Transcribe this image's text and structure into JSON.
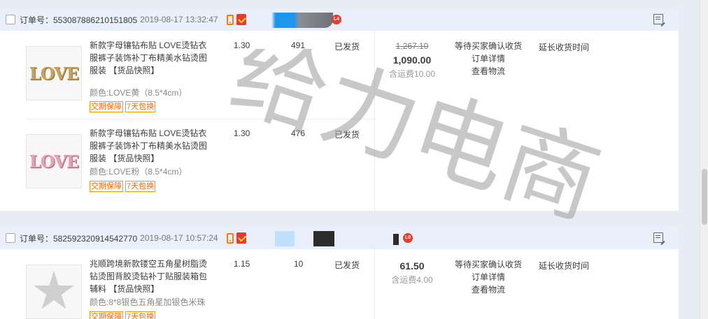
{
  "orders": [
    {
      "order_no": "订单号：553087886210151805",
      "time": "2019-08-17 13:32:47",
      "level_badge": "L4",
      "items": [
        {
          "thumb_text": "LOVE",
          "title": "新款字母镶钻布贴 LOVE烫钻衣服裤子装饰补丁布精美水钻烫图服装 【货品快照】",
          "sku": "颜色:LOVE黄（8.5*4cm）",
          "tags": [
            "交期保障",
            "7天包换"
          ],
          "price": "1.30",
          "qty": "491",
          "status": "已发货"
        },
        {
          "thumb_text": "LOVE",
          "title": "新款字母镶钻布贴 LOVE烫钻衣服裤子装饰补丁布精美水钻烫图服装 【货品快照】",
          "sku": "颜色:LOVE粉（8.5*4cm）",
          "tags": [
            "交期保障",
            "7天包换"
          ],
          "price": "1.30",
          "qty": "476",
          "status": "已发货"
        }
      ],
      "total_original": "1,267.10",
      "total": "1,090.00",
      "shipping": "含运费10.00",
      "trade_status": "等待买家确认收货",
      "detail_link": "订单详情",
      "logistics_link": "查看物流",
      "extend_link": "延长收货时间"
    },
    {
      "order_no": "订单号：582592320914542770",
      "time": "2019-08-17 10:57:24",
      "level_badge": "L0",
      "items": [
        {
          "title": "兆顺跨境新款镂空五角星树脂烫钻烫图背胶烫钻补丁贴服装箱包辅料 【货品快照】",
          "sku": "颜色:8*8银色五角星加银色米珠",
          "tags": [
            "交期保障",
            "7天包换"
          ],
          "price": "1.15",
          "qty": "10",
          "status": "已发货"
        }
      ],
      "total": "61.50",
      "shipping": "含运费4.00",
      "trade_status": "等待买家确认收货",
      "detail_link": "订单详情",
      "logistics_link": "查看物流",
      "extend_link": "延长收货时间"
    }
  ],
  "watermark": "给力电商",
  "icons": {
    "checkbox": "checkbox-icon",
    "mobile": "mobile-order-icon",
    "guarantee": "guarantee-badge-icon",
    "remark": "remark-flag-icon"
  },
  "colors": {
    "header_bg": "#e9f0fb",
    "tag_orange": "#ff6600",
    "badge_red": "#e53c2d"
  }
}
